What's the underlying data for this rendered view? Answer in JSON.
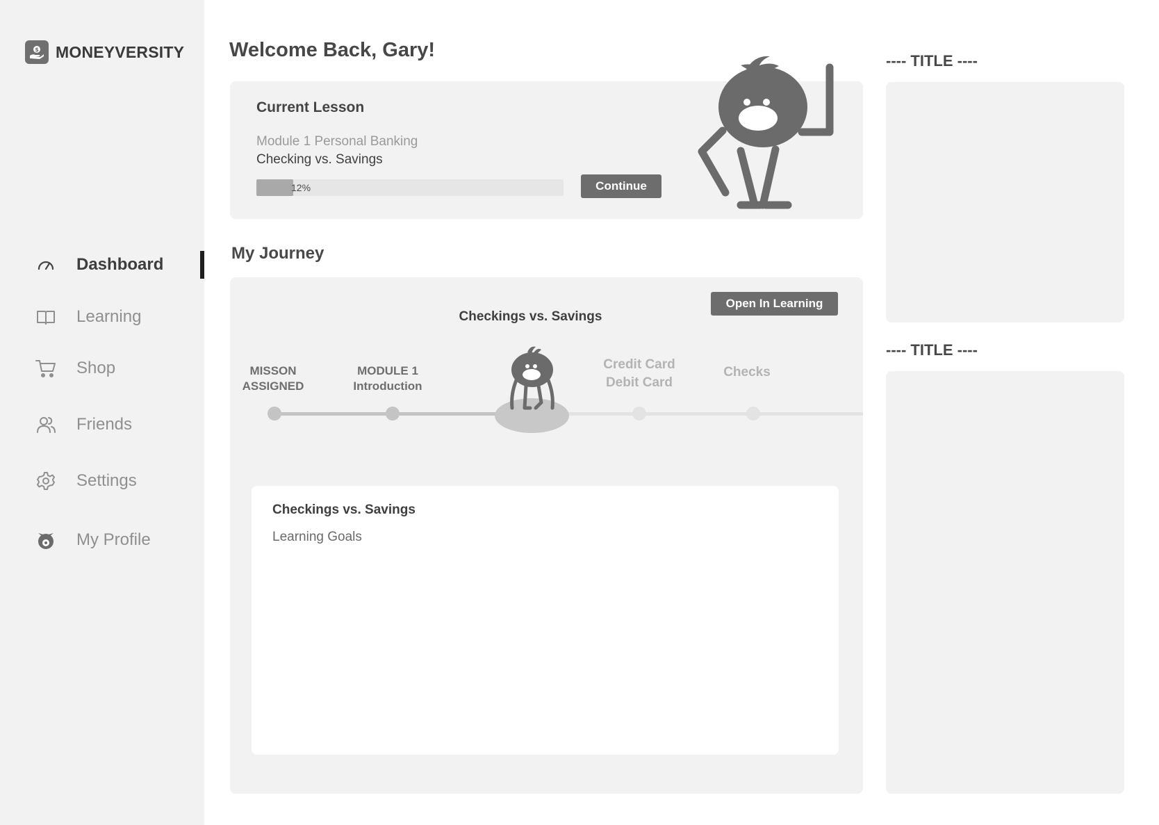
{
  "brand": {
    "name": "MONEYVERSITY"
  },
  "sidebar": {
    "items": [
      {
        "label": "Dashboard",
        "icon": "gauge-icon",
        "active": true
      },
      {
        "label": "Learning",
        "icon": "book-icon",
        "active": false
      },
      {
        "label": "Shop",
        "icon": "cart-icon",
        "active": false
      },
      {
        "label": "Friends",
        "icon": "users-icon",
        "active": false
      },
      {
        "label": "Settings",
        "icon": "gear-icon",
        "active": false
      },
      {
        "label": "My Profile",
        "icon": "mascot-face-icon",
        "active": false
      }
    ]
  },
  "header": {
    "welcome": "Welcome Back, Gary!"
  },
  "current_lesson": {
    "heading": "Current Lesson",
    "module": "Module 1 Personal Banking",
    "title": "Checking vs. Savings",
    "progress": 0.12,
    "progress_label": "12%",
    "continue_label": "Continue"
  },
  "journey": {
    "heading": "My Journey",
    "open_label": "Open In Learning",
    "current": "Checkings vs. Savings",
    "milestones": [
      {
        "line1": "MISSON",
        "line2": "ASSIGNED",
        "status": "done"
      },
      {
        "line1": "MODULE 1",
        "line2": "Introduction",
        "status": "done"
      },
      {
        "line1": "Credit Card",
        "line2": "Debit Card",
        "status": "todo"
      },
      {
        "line1": "Checks",
        "line2": "",
        "status": "todo"
      }
    ],
    "detail": {
      "title": "Checkings vs. Savings",
      "subtitle": "Learning Goals"
    }
  },
  "right_panels": [
    {
      "title": "---- TITLE ----"
    },
    {
      "title": "---- TITLE ----"
    }
  ],
  "colors": {
    "sidebar_bg": "#f2f2f2",
    "card_bg": "#f2f2f2",
    "button_bg": "#6d6d6d",
    "mascot": "#6b6b6b",
    "active_indicator": "#1f1f1f"
  }
}
